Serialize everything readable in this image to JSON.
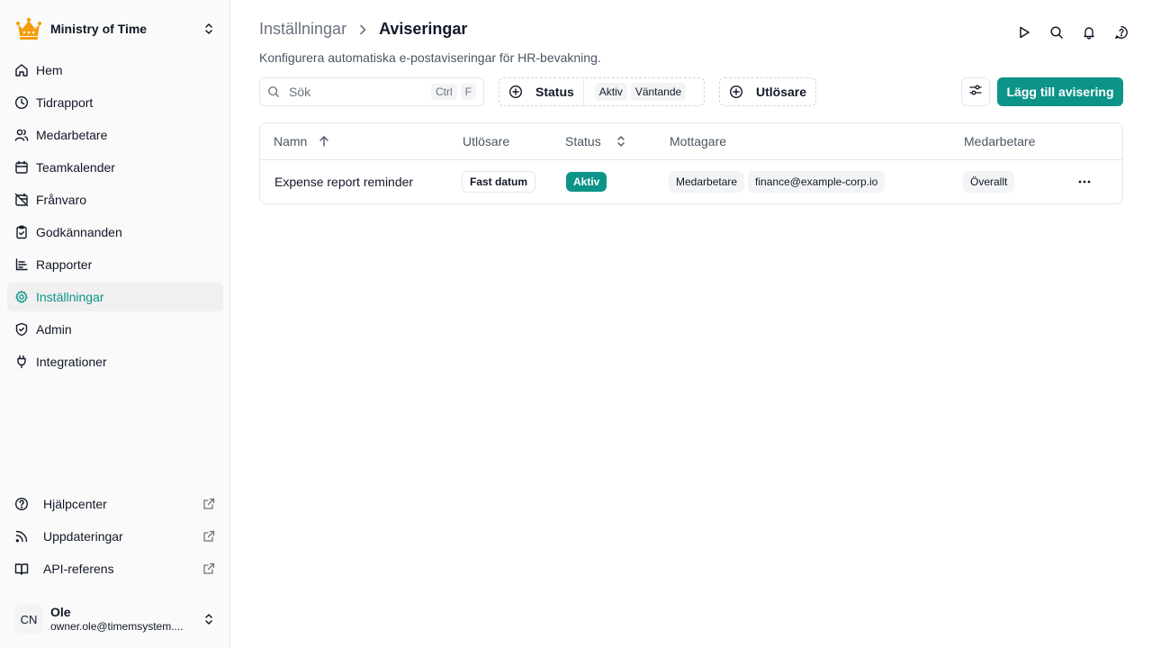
{
  "brand": {
    "name": "Ministry of Time",
    "logo_icon": "crown-icon",
    "logo_color": "#f59e0b"
  },
  "nav": {
    "items": [
      {
        "label": "Hem",
        "icon": "home-icon"
      },
      {
        "label": "Tidrapport",
        "icon": "clock-icon"
      },
      {
        "label": "Medarbetare",
        "icon": "users-icon"
      },
      {
        "label": "Teamkalender",
        "icon": "calendar-icon"
      },
      {
        "label": "Frånvaro",
        "icon": "calendar-off-icon"
      },
      {
        "label": "Godkännanden",
        "icon": "clipboard-check-icon"
      },
      {
        "label": "Rapporter",
        "icon": "report-icon"
      },
      {
        "label": "Inställningar",
        "icon": "gear-icon",
        "active": true
      },
      {
        "label": "Admin",
        "icon": "shield-icon"
      },
      {
        "label": "Integrationer",
        "icon": "plug-icon"
      }
    ]
  },
  "footer_links": [
    {
      "label": "Hjälpcenter",
      "icon": "help-circle-icon"
    },
    {
      "label": "Uppdateringar",
      "icon": "rss-icon"
    },
    {
      "label": "API-referens",
      "icon": "book-icon"
    }
  ],
  "user": {
    "initials": "CN",
    "name": "Ole",
    "email": "owner.ole@timemsystem...."
  },
  "header": {
    "breadcrumb_parent": "Inställningar",
    "breadcrumb_current": "Aviseringar",
    "subtitle": "Konfigurera automatiska e-postaviseringar för HR-bevakning."
  },
  "toolbar": {
    "search_placeholder": "Sök",
    "search_value": "",
    "kbd_ctrl": "Ctrl",
    "kbd_f": "F",
    "status_filter": {
      "label": "Status",
      "chips": [
        "Aktiv",
        "Väntande"
      ]
    },
    "trigger_filter": {
      "label": "Utlösare"
    },
    "add_button": "Lägg till avisering"
  },
  "table": {
    "columns": [
      "Namn",
      "Utlösare",
      "Status",
      "Mottagare",
      "Medarbetare"
    ],
    "rows": [
      {
        "name": "Expense report reminder",
        "trigger": "Fast datum",
        "status": "Aktiv",
        "recipients": [
          "Medarbetare",
          "finance@example-corp.io"
        ],
        "employees": "Överallt"
      }
    ]
  },
  "colors": {
    "accent": "#0d9488",
    "brand": "#f59e0b"
  }
}
